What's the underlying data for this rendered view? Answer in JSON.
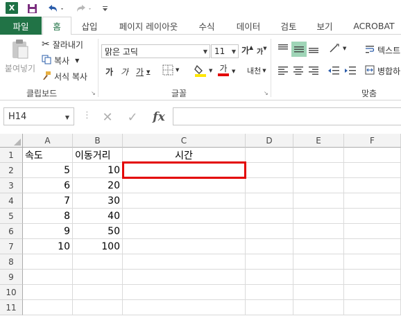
{
  "quick_access": {
    "app_icon": "X",
    "save_icon": "floppy-disk-icon",
    "undo_icon": "undo-icon",
    "redo_icon": "redo-icon",
    "customize_icon": "customize-qat-icon"
  },
  "tabs": [
    {
      "label": "파일"
    },
    {
      "label": "홈"
    },
    {
      "label": "삽입"
    },
    {
      "label": "페이지 레이아웃"
    },
    {
      "label": "수식"
    },
    {
      "label": "데이터"
    },
    {
      "label": "검토"
    },
    {
      "label": "보기"
    },
    {
      "label": "ACROBAT"
    }
  ],
  "ribbon": {
    "clipboard": {
      "paste": "붙여넣기",
      "cut": "잘라내기",
      "copy": "복사",
      "format_painter": "서식 복사",
      "group_label": "클립보드"
    },
    "font": {
      "font_name": "맑은 고딕",
      "font_size": "11",
      "grow": "가",
      "shrink": "가",
      "bold": "가",
      "italic": "가",
      "underline": "가",
      "font_color_glyph": "가",
      "phonetic": "내천",
      "group_label": "글꼴"
    },
    "alignment": {
      "wrap_text": "텍스트",
      "merge": "병합하",
      "group_label": "맞춤"
    }
  },
  "formula_bar": {
    "name_box": "H14",
    "fx": "fx",
    "formula": ""
  },
  "sheet": {
    "columns": [
      "A",
      "B",
      "C",
      "D",
      "E",
      "F"
    ],
    "rows": [
      "1",
      "2",
      "3",
      "4",
      "5",
      "6",
      "7",
      "8",
      "9",
      "10",
      "11"
    ],
    "cells": {
      "A1": "속도",
      "B1": "이동거리",
      "C1": "시간",
      "A2": "5",
      "B2": "10",
      "A3": "6",
      "B3": "20",
      "A4": "7",
      "B4": "30",
      "A5": "8",
      "B5": "40",
      "A6": "9",
      "B6": "50",
      "A7": "10",
      "B7": "100"
    },
    "highlight_cell": "C2",
    "highlight_color": "#e30000"
  },
  "colors": {
    "excel_green": "#217346",
    "header_bg": "#f3f3f3"
  }
}
